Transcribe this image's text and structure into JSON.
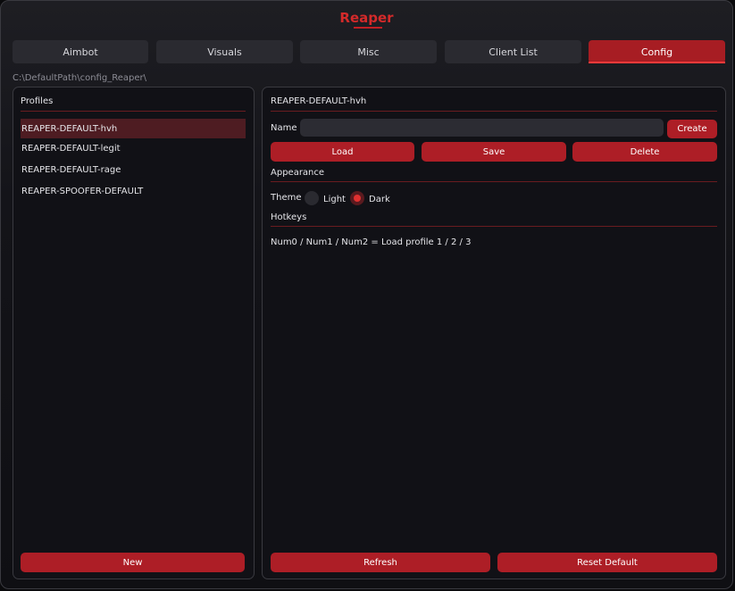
{
  "app": {
    "title": "Reaper"
  },
  "tabs": [
    {
      "label": "Aimbot"
    },
    {
      "label": "Visuals"
    },
    {
      "label": "Misc"
    },
    {
      "label": "Client List"
    },
    {
      "label": "Config",
      "active": true
    }
  ],
  "path": "C:\\DefaultPath\\config_Reaper\\",
  "profiles": {
    "heading": "Profiles",
    "items": [
      {
        "name": "REAPER-DEFAULT-hvh",
        "selected": true
      },
      {
        "name": "REAPER-DEFAULT-legit"
      },
      {
        "name": "REAPER-DEFAULT-rage"
      },
      {
        "name": "REAPER-SPOOFER-DEFAULT"
      }
    ],
    "new_label": "New"
  },
  "config": {
    "heading": "REAPER-DEFAULT-hvh",
    "name_label": "Name",
    "name_value": "",
    "create_label": "Create",
    "load_label": "Load",
    "save_label": "Save",
    "delete_label": "Delete",
    "appearance": {
      "heading": "Appearance",
      "theme_label": "Theme",
      "options": [
        {
          "label": "Light",
          "checked": false
        },
        {
          "label": "Dark",
          "checked": true
        }
      ]
    },
    "hotkeys": {
      "heading": "Hotkeys",
      "text": "Num0 / Num1 / Num2  =  Load profile 1 / 2 / 3"
    },
    "refresh_label": "Refresh",
    "reset_label": "Reset Default"
  },
  "colors": {
    "accent": "#ad1e26",
    "title": "#d42a2a",
    "background": "#111116"
  }
}
